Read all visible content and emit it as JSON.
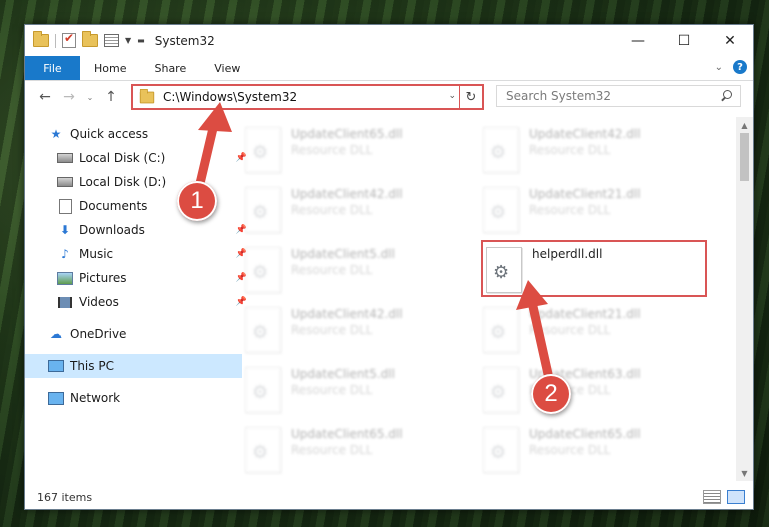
{
  "window": {
    "title": "System32",
    "controls": {
      "minimize": "—",
      "maximize": "☐",
      "close": "✕"
    }
  },
  "ribbon": {
    "tabs": [
      "File",
      "Home",
      "Share",
      "View"
    ]
  },
  "address": {
    "path": "C:\\Windows\\System32",
    "search_placeholder": "Search System32"
  },
  "sidebar": {
    "items": [
      {
        "label": "Quick access",
        "icon": "star-icon"
      },
      {
        "label": "Local Disk (C:)",
        "icon": "drive-icon"
      },
      {
        "label": "Local Disk (D:)",
        "icon": "drive-icon"
      },
      {
        "label": "Documents",
        "icon": "documents-icon"
      },
      {
        "label": "Downloads",
        "icon": "downloads-icon"
      },
      {
        "label": "Music",
        "icon": "music-icon"
      },
      {
        "label": "Pictures",
        "icon": "pictures-icon"
      },
      {
        "label": "Videos",
        "icon": "videos-icon"
      },
      {
        "label": "OneDrive",
        "icon": "onedrive-icon"
      },
      {
        "label": "This PC",
        "icon": "this-pc-icon"
      },
      {
        "label": "Network",
        "icon": "network-icon"
      }
    ]
  },
  "files": [
    {
      "name": "UpdateClient65.dll",
      "type": "Resource DLL"
    },
    {
      "name": "UpdateClient42.dll",
      "type": "Resource DLL"
    },
    {
      "name": "UpdateClient42.dll",
      "type": "Resource DLL"
    },
    {
      "name": "UpdateClient21.dll",
      "type": "Resource DLL"
    },
    {
      "name": "UpdateClient5.dll",
      "type": "Resource DLL"
    },
    {
      "name": "helperdll.dll",
      "type": ""
    },
    {
      "name": "UpdateClient42.dll",
      "type": "Resource DLL"
    },
    {
      "name": "UpdateClient21.dll",
      "type": "Resource DLL"
    },
    {
      "name": "UpdateClient5.dll",
      "type": "Resource DLL"
    },
    {
      "name": "UpdateClient63.dll",
      "type": "Resource DLL"
    },
    {
      "name": "UpdateClient65.dll",
      "type": "Resource DLL"
    },
    {
      "name": "UpdateClient65.dll",
      "type": "Resource DLL"
    }
  ],
  "status": {
    "item_count": "167 items"
  },
  "annotations": {
    "step1": "1",
    "step2": "2"
  },
  "colors": {
    "accent": "#1979ca",
    "highlight": "#d95555",
    "callout": "#dc4c42"
  }
}
